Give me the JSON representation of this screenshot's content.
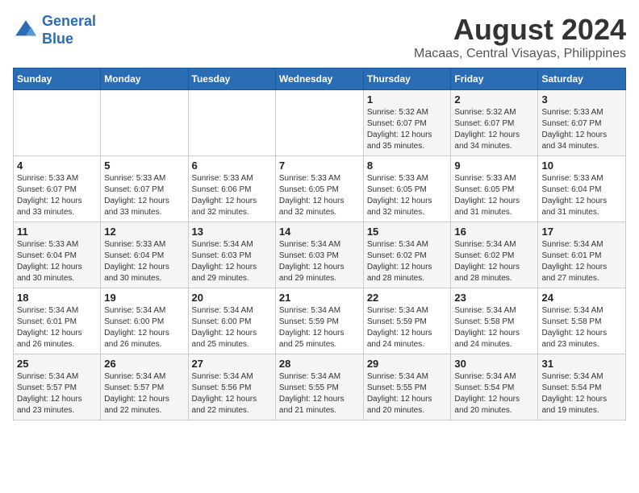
{
  "logo": {
    "line1": "General",
    "line2": "Blue"
  },
  "title": "August 2024",
  "subtitle": "Macaas, Central Visayas, Philippines",
  "weekdays": [
    "Sunday",
    "Monday",
    "Tuesday",
    "Wednesday",
    "Thursday",
    "Friday",
    "Saturday"
  ],
  "weeks": [
    [
      {
        "day": "",
        "info": ""
      },
      {
        "day": "",
        "info": ""
      },
      {
        "day": "",
        "info": ""
      },
      {
        "day": "",
        "info": ""
      },
      {
        "day": "1",
        "info": "Sunrise: 5:32 AM\nSunset: 6:07 PM\nDaylight: 12 hours\nand 35 minutes."
      },
      {
        "day": "2",
        "info": "Sunrise: 5:32 AM\nSunset: 6:07 PM\nDaylight: 12 hours\nand 34 minutes."
      },
      {
        "day": "3",
        "info": "Sunrise: 5:33 AM\nSunset: 6:07 PM\nDaylight: 12 hours\nand 34 minutes."
      }
    ],
    [
      {
        "day": "4",
        "info": "Sunrise: 5:33 AM\nSunset: 6:07 PM\nDaylight: 12 hours\nand 33 minutes."
      },
      {
        "day": "5",
        "info": "Sunrise: 5:33 AM\nSunset: 6:07 PM\nDaylight: 12 hours\nand 33 minutes."
      },
      {
        "day": "6",
        "info": "Sunrise: 5:33 AM\nSunset: 6:06 PM\nDaylight: 12 hours\nand 32 minutes."
      },
      {
        "day": "7",
        "info": "Sunrise: 5:33 AM\nSunset: 6:05 PM\nDaylight: 12 hours\nand 32 minutes."
      },
      {
        "day": "8",
        "info": "Sunrise: 5:33 AM\nSunset: 6:05 PM\nDaylight: 12 hours\nand 32 minutes."
      },
      {
        "day": "9",
        "info": "Sunrise: 5:33 AM\nSunset: 6:05 PM\nDaylight: 12 hours\nand 31 minutes."
      },
      {
        "day": "10",
        "info": "Sunrise: 5:33 AM\nSunset: 6:04 PM\nDaylight: 12 hours\nand 31 minutes."
      }
    ],
    [
      {
        "day": "11",
        "info": "Sunrise: 5:33 AM\nSunset: 6:04 PM\nDaylight: 12 hours\nand 30 minutes."
      },
      {
        "day": "12",
        "info": "Sunrise: 5:33 AM\nSunset: 6:04 PM\nDaylight: 12 hours\nand 30 minutes."
      },
      {
        "day": "13",
        "info": "Sunrise: 5:34 AM\nSunset: 6:03 PM\nDaylight: 12 hours\nand 29 minutes."
      },
      {
        "day": "14",
        "info": "Sunrise: 5:34 AM\nSunset: 6:03 PM\nDaylight: 12 hours\nand 29 minutes."
      },
      {
        "day": "15",
        "info": "Sunrise: 5:34 AM\nSunset: 6:02 PM\nDaylight: 12 hours\nand 28 minutes."
      },
      {
        "day": "16",
        "info": "Sunrise: 5:34 AM\nSunset: 6:02 PM\nDaylight: 12 hours\nand 28 minutes."
      },
      {
        "day": "17",
        "info": "Sunrise: 5:34 AM\nSunset: 6:01 PM\nDaylight: 12 hours\nand 27 minutes."
      }
    ],
    [
      {
        "day": "18",
        "info": "Sunrise: 5:34 AM\nSunset: 6:01 PM\nDaylight: 12 hours\nand 26 minutes."
      },
      {
        "day": "19",
        "info": "Sunrise: 5:34 AM\nSunset: 6:00 PM\nDaylight: 12 hours\nand 26 minutes."
      },
      {
        "day": "20",
        "info": "Sunrise: 5:34 AM\nSunset: 6:00 PM\nDaylight: 12 hours\nand 25 minutes."
      },
      {
        "day": "21",
        "info": "Sunrise: 5:34 AM\nSunset: 5:59 PM\nDaylight: 12 hours\nand 25 minutes."
      },
      {
        "day": "22",
        "info": "Sunrise: 5:34 AM\nSunset: 5:59 PM\nDaylight: 12 hours\nand 24 minutes."
      },
      {
        "day": "23",
        "info": "Sunrise: 5:34 AM\nSunset: 5:58 PM\nDaylight: 12 hours\nand 24 minutes."
      },
      {
        "day": "24",
        "info": "Sunrise: 5:34 AM\nSunset: 5:58 PM\nDaylight: 12 hours\nand 23 minutes."
      }
    ],
    [
      {
        "day": "25",
        "info": "Sunrise: 5:34 AM\nSunset: 5:57 PM\nDaylight: 12 hours\nand 23 minutes."
      },
      {
        "day": "26",
        "info": "Sunrise: 5:34 AM\nSunset: 5:57 PM\nDaylight: 12 hours\nand 22 minutes."
      },
      {
        "day": "27",
        "info": "Sunrise: 5:34 AM\nSunset: 5:56 PM\nDaylight: 12 hours\nand 22 minutes."
      },
      {
        "day": "28",
        "info": "Sunrise: 5:34 AM\nSunset: 5:55 PM\nDaylight: 12 hours\nand 21 minutes."
      },
      {
        "day": "29",
        "info": "Sunrise: 5:34 AM\nSunset: 5:55 PM\nDaylight: 12 hours\nand 20 minutes."
      },
      {
        "day": "30",
        "info": "Sunrise: 5:34 AM\nSunset: 5:54 PM\nDaylight: 12 hours\nand 20 minutes."
      },
      {
        "day": "31",
        "info": "Sunrise: 5:34 AM\nSunset: 5:54 PM\nDaylight: 12 hours\nand 19 minutes."
      }
    ]
  ]
}
